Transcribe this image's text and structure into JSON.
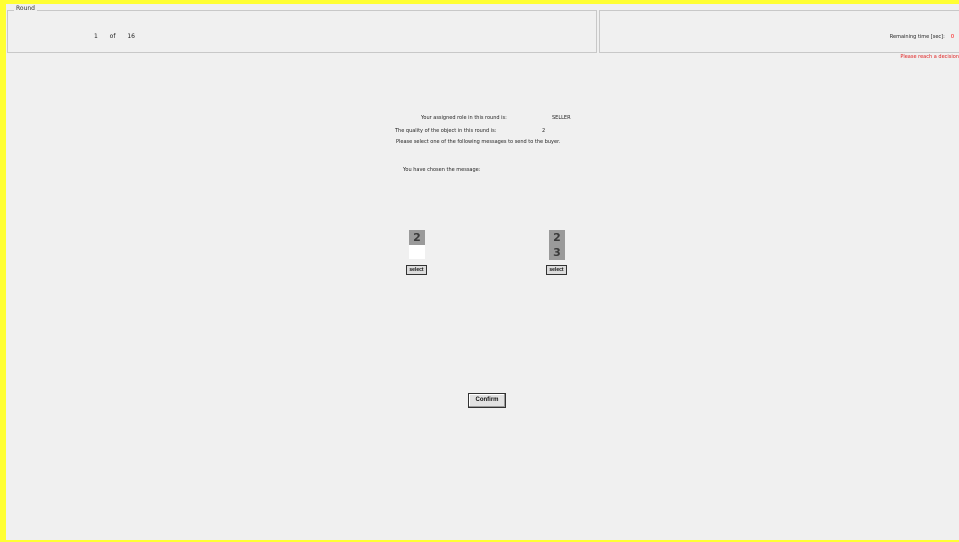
{
  "colors": {
    "frame": "#ffff33",
    "background": "#f0f0f0",
    "alert": "#e02020",
    "card_fill": "#9a9a9a"
  },
  "header": {
    "round_legend": "Round",
    "round_current": "1",
    "round_of": "of",
    "round_total": "16",
    "time_label": "Remaining time [sec]:",
    "time_value": "0",
    "warning": "Please reach a decision"
  },
  "info": {
    "role_label": "Your assigned role in this round is:",
    "role_value": "SELLER",
    "quality_label": "The quality of the object in this round is:",
    "quality_value": "2",
    "instruction": "Please select one of the following messages to send to the buyer.",
    "chosen_label": "You have chosen the message:"
  },
  "messages": [
    {
      "top": "2",
      "bottom": "",
      "button": "select"
    },
    {
      "top": "2",
      "bottom": "3",
      "button": "select"
    }
  ],
  "confirm_label": "Confirm"
}
